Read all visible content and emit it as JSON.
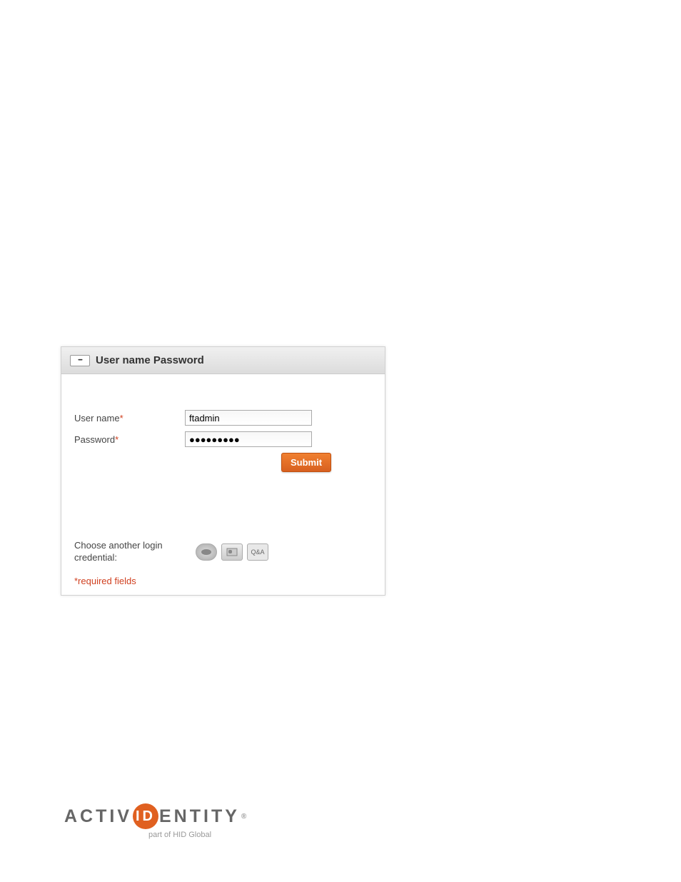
{
  "panel": {
    "title": "User name Password",
    "iconDots": "•••••"
  },
  "form": {
    "username": {
      "label": "User name",
      "value": "ftadmin"
    },
    "password": {
      "label": "Password",
      "value": "●●●●●●●●●"
    },
    "submitLabel": "Submit"
  },
  "altCredentials": {
    "label": "Choose another login credential:",
    "icons": {
      "token": "",
      "card": "",
      "qa": "Q&A"
    }
  },
  "requiredNote": "*required fields",
  "logo": {
    "part1": "ACTIV",
    "id": "ID",
    "part2": "ENTITY",
    "sub": "part of HID Global"
  }
}
